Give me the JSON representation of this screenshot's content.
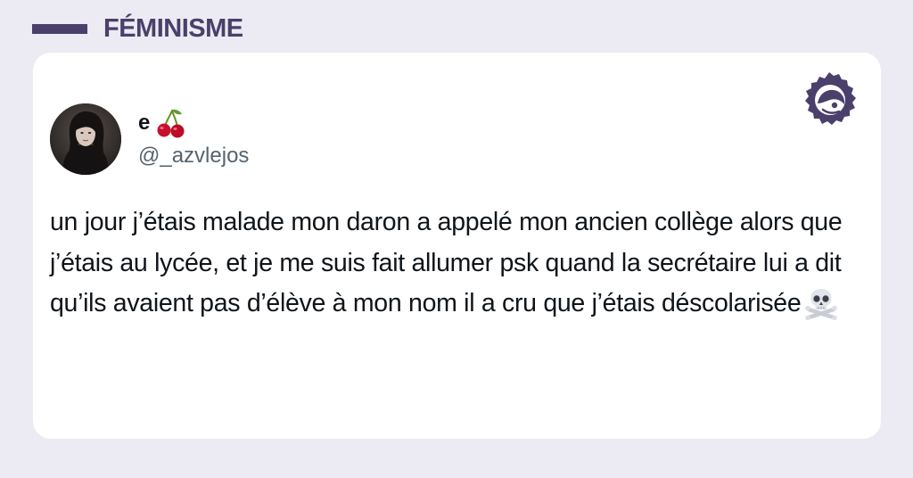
{
  "category": {
    "label": "FÉMINISME"
  },
  "tweet": {
    "username": "e",
    "username_emoji": "cherries-emoji",
    "handle": "@_azvlejos",
    "text": "un jour j’étais malade mon daron a appelé mon ancien collège alors que j’étais au lycée, et je me suis fait allumer psk quand la secrétaire lui a dit qu’ils avaient pas d’élève à mon nom il a cru que j’étais déscolarisée",
    "text_emoji": "skull-and-crossbones-emoji"
  },
  "colors": {
    "background": "#ecebf3",
    "accent": "#4b3f6b",
    "card": "#ffffff",
    "handle": "#536471",
    "text": "#0f1419"
  }
}
